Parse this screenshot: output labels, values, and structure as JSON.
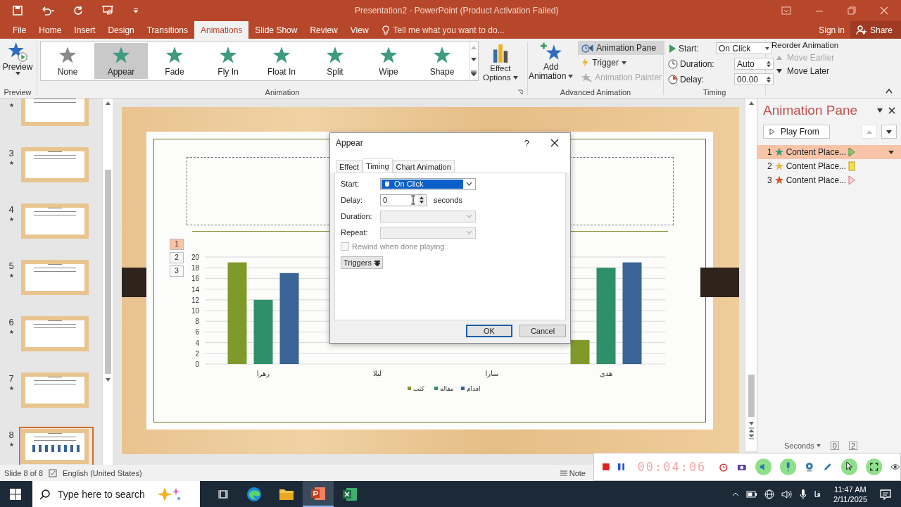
{
  "window": {
    "title": "Presentation2 - PowerPoint (Product Activation Failed)"
  },
  "tabs": [
    {
      "label": "File",
      "selected": false
    },
    {
      "label": "Home",
      "selected": false
    },
    {
      "label": "Insert",
      "selected": false
    },
    {
      "label": "Design",
      "selected": false
    },
    {
      "label": "Transitions",
      "selected": false
    },
    {
      "label": "Animations",
      "selected": true
    },
    {
      "label": "Slide Show",
      "selected": false
    },
    {
      "label": "Review",
      "selected": false
    },
    {
      "label": "View",
      "selected": false
    }
  ],
  "tell_me": {
    "placeholder": "Tell me what you want to do..."
  },
  "account": {
    "sign_in": "Sign in",
    "share": "Share"
  },
  "ribbon": {
    "preview": {
      "label": "Preview",
      "group": "Preview"
    },
    "gallery": {
      "group": "Animation",
      "items": [
        {
          "label": "None",
          "kind": "none",
          "selected": false
        },
        {
          "label": "Appear",
          "kind": "effect",
          "selected": true
        },
        {
          "label": "Fade",
          "kind": "effect",
          "selected": false
        },
        {
          "label": "Fly In",
          "kind": "effect",
          "selected": false
        },
        {
          "label": "Float In",
          "kind": "effect",
          "selected": false
        },
        {
          "label": "Split",
          "kind": "effect",
          "selected": false
        },
        {
          "label": "Wipe",
          "kind": "effect",
          "selected": false
        },
        {
          "label": "Shape",
          "kind": "effect",
          "selected": false
        }
      ]
    },
    "effect_options": {
      "line_1": "Effect",
      "line_2": "Options"
    },
    "advanced": {
      "group": "Advanced Animation",
      "add_1": "Add",
      "add_2": "Animation",
      "pane_button": {
        "label": "Animation Pane",
        "on": true
      },
      "trigger": "Trigger",
      "painter": {
        "label": "Animation Painter",
        "disabled": true
      }
    },
    "timing": {
      "group": "Timing",
      "start_label": "Start:",
      "start_value": "On Click",
      "duration_label": "Duration:",
      "duration_value": "Auto",
      "delay_label": "Delay:",
      "delay_value": "00.00"
    },
    "reorder": {
      "title": "Reorder Animation",
      "earlier": {
        "label": "Move Earlier",
        "disabled": true
      },
      "later": {
        "label": "Move Later",
        "disabled": false
      }
    }
  },
  "thumbnails": [
    {
      "selected": false
    },
    {
      "number": "3",
      "selected": false
    },
    {
      "number": "4",
      "selected": false
    },
    {
      "number": "5",
      "selected": false
    },
    {
      "number": "6",
      "selected": false
    },
    {
      "number": "7",
      "selected": false
    },
    {
      "number": "8",
      "selected": true
    }
  ],
  "slide": {
    "sequence_tags": [
      {
        "label": "1",
        "selected": true
      },
      {
        "label": "2",
        "selected": false
      },
      {
        "label": "3",
        "selected": false
      }
    ],
    "chart_data": {
      "type": "bar",
      "grid": true,
      "legend": true,
      "categories": [
        "زهرا",
        "لیلا",
        "سارا",
        "هدی"
      ],
      "ylim": [
        0,
        20
      ],
      "yticks": [
        {
          "value": 0,
          "label": "0"
        },
        {
          "value": 2,
          "label": "2"
        },
        {
          "value": 4,
          "label": "4"
        },
        {
          "value": 6,
          "label": "6"
        },
        {
          "value": 8,
          "label": "8"
        },
        {
          "value": 10,
          "label": "10"
        },
        {
          "value": 12,
          "label": "12"
        },
        {
          "value": 14,
          "label": "14"
        },
        {
          "value": 16,
          "label": "16"
        },
        {
          "value": 18,
          "label": "18"
        },
        {
          "value": 20,
          "label": "20"
        }
      ],
      "series": [
        {
          "name": "کتب",
          "color": "#7f9a2a",
          "values": [
            19,
            null,
            null,
            4.5
          ]
        },
        {
          "name": "مقاله",
          "color": "#2f8f6a",
          "values": [
            12,
            null,
            null,
            18
          ]
        },
        {
          "name": "اقدام",
          "color": "#3a6496",
          "values": [
            17,
            null,
            null,
            19
          ]
        }
      ]
    }
  },
  "dialog": {
    "title": "Appear",
    "help": "?",
    "tabs": [
      {
        "label": "Effect",
        "selected": false
      },
      {
        "label": "Timing",
        "selected": true
      },
      {
        "label": "Chart Animation",
        "selected": false
      }
    ],
    "fields": [
      {
        "kind": "select",
        "label": "Start:",
        "value": "On Click",
        "highlighted": true,
        "disabled": false
      },
      {
        "kind": "spin",
        "label": "Delay:",
        "value": "0",
        "unit": "seconds",
        "highlighted": false,
        "disabled": false
      },
      {
        "kind": "select",
        "label": "Duration:",
        "highlighted": false,
        "disabled": true
      },
      {
        "kind": "select",
        "label": "Repeat:",
        "highlighted": false,
        "disabled": true
      }
    ],
    "rewind": {
      "label": "Rewind when done playing",
      "checked": false,
      "disabled": true
    },
    "triggers": "Triggers",
    "ok": "OK",
    "cancel": "Cancel"
  },
  "animation_pane": {
    "title": "Animation Pane",
    "play_from": "Play From",
    "items": [
      {
        "number": "1",
        "label": "Content Place...",
        "kind": "entrance",
        "selected": true
      },
      {
        "number": "2",
        "label": "Content Place...",
        "kind": "emphasis",
        "selected": false
      },
      {
        "number": "3",
        "label": "Content Place...",
        "kind": "exit",
        "selected": false
      }
    ],
    "seconds": "Seconds",
    "tick_0": "0",
    "tick_2": "2"
  },
  "status_bar": {
    "slide": "Slide 8 of 8",
    "language": "English (United States)",
    "notes": "Note"
  },
  "recorder": {
    "timer": "00:04:06"
  },
  "taskbar": {
    "search": {
      "placeholder": "Type here to search"
    },
    "language": "فا",
    "time": "11:47 AM",
    "date": "2/11/2025"
  }
}
